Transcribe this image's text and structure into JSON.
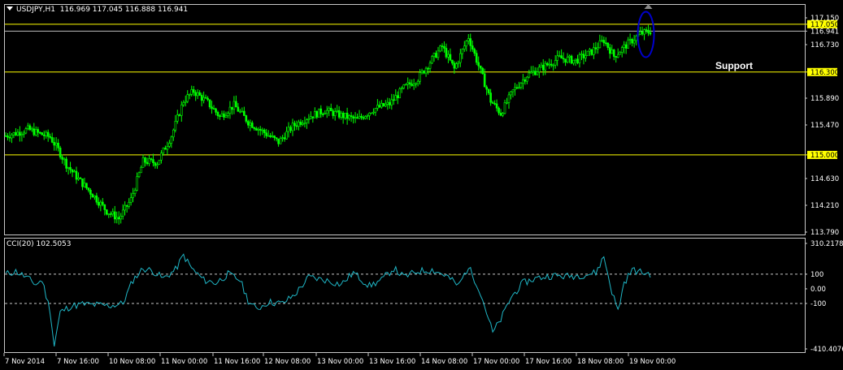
{
  "chart_header": {
    "menu_icon": "triangle-down-icon",
    "symbol": "USDJPY,H1",
    "ohlc": "116.969 117.045 116.888 116.941"
  },
  "annotation": {
    "support_label": "Support"
  },
  "cci": {
    "title": "CCI(20) 102.5053"
  },
  "colors": {
    "background": "#000000",
    "candles": "#00ff00",
    "levels": "#ffff00",
    "cci_line": "#1fb7c7",
    "ellipse": "#0000cc",
    "grid": "#c8c8c8"
  },
  "chart_data": [
    {
      "type": "candlestick",
      "symbol": "USDJPY",
      "timeframe": "H1",
      "ylim": [
        113.79,
        117.15
      ],
      "y_ticks": [
        "117.150",
        "116.730",
        "115.890",
        "115.470",
        "114.630",
        "114.210",
        "113.790"
      ],
      "x_ticks": [
        "7 Nov 2014",
        "7 Nov 16:00",
        "10 Nov 08:00",
        "11 Nov 00:00",
        "11 Nov 16:00",
        "12 Nov 08:00",
        "13 Nov 00:00",
        "13 Nov 16:00",
        "14 Nov 08:00",
        "17 Nov 00:00",
        "17 Nov 16:00",
        "18 Nov 08:00",
        "19 Nov 00:00"
      ],
      "horizontal_levels": [
        {
          "value": 117.05,
          "label": "117.050",
          "highlight": true
        },
        {
          "value": 116.941,
          "label": "116.941",
          "highlight": false
        },
        {
          "value": 116.3,
          "label": "116.300",
          "highlight": true
        },
        {
          "value": 115.0,
          "label": "115.000",
          "highlight": true
        }
      ],
      "close_path": [
        {
          "bar": 0,
          "close": 115.3
        },
        {
          "bar": 6,
          "close": 115.35
        },
        {
          "bar": 11,
          "close": 115.4
        },
        {
          "bar": 17,
          "close": 115.33
        },
        {
          "bar": 22,
          "close": 115.28
        },
        {
          "bar": 26,
          "close": 115.08
        },
        {
          "bar": 30,
          "close": 114.85
        },
        {
          "bar": 36,
          "close": 114.62
        },
        {
          "bar": 43,
          "close": 114.38
        },
        {
          "bar": 50,
          "close": 114.12
        },
        {
          "bar": 56,
          "close": 114.0
        },
        {
          "bar": 62,
          "close": 114.3
        },
        {
          "bar": 68,
          "close": 114.9
        },
        {
          "bar": 75,
          "close": 114.88
        },
        {
          "bar": 82,
          "close": 115.3
        },
        {
          "bar": 88,
          "close": 115.85
        },
        {
          "bar": 93,
          "close": 116.0
        },
        {
          "bar": 100,
          "close": 115.82
        },
        {
          "bar": 106,
          "close": 115.6
        },
        {
          "bar": 113,
          "close": 115.78
        },
        {
          "bar": 120,
          "close": 115.52
        },
        {
          "bar": 128,
          "close": 115.35
        },
        {
          "bar": 135,
          "close": 115.2
        },
        {
          "bar": 142,
          "close": 115.45
        },
        {
          "bar": 150,
          "close": 115.6
        },
        {
          "bar": 158,
          "close": 115.7
        },
        {
          "bar": 166,
          "close": 115.62
        },
        {
          "bar": 174,
          "close": 115.55
        },
        {
          "bar": 182,
          "close": 115.72
        },
        {
          "bar": 190,
          "close": 115.8
        },
        {
          "bar": 197,
          "close": 116.05
        },
        {
          "bar": 204,
          "close": 116.2
        },
        {
          "bar": 211,
          "close": 116.5
        },
        {
          "bar": 216,
          "close": 116.7
        },
        {
          "bar": 222,
          "close": 116.35
        },
        {
          "bar": 229,
          "close": 116.85
        },
        {
          "bar": 234,
          "close": 116.4
        },
        {
          "bar": 240,
          "close": 115.85
        },
        {
          "bar": 245,
          "close": 115.65
        },
        {
          "bar": 251,
          "close": 116.0
        },
        {
          "bar": 258,
          "close": 116.25
        },
        {
          "bar": 266,
          "close": 116.38
        },
        {
          "bar": 274,
          "close": 116.52
        },
        {
          "bar": 282,
          "close": 116.48
        },
        {
          "bar": 290,
          "close": 116.62
        },
        {
          "bar": 296,
          "close": 116.8
        },
        {
          "bar": 301,
          "close": 116.55
        },
        {
          "bar": 307,
          "close": 116.72
        },
        {
          "bar": 314,
          "close": 116.9
        },
        {
          "bar": 319,
          "close": 116.94
        }
      ]
    },
    {
      "type": "line",
      "name": "CCI(20)",
      "value": 102.5053,
      "ylim": [
        -410.4076,
        310.2178
      ],
      "y_ticks": [
        "310.2178",
        "100",
        "0.00",
        "-100",
        "-410.4076"
      ],
      "reference_lines": [
        100,
        -100
      ],
      "points": [
        {
          "bar": 0,
          "y": 100
        },
        {
          "bar": 5,
          "y": 120
        },
        {
          "bar": 10,
          "y": 80
        },
        {
          "bar": 15,
          "y": 30
        },
        {
          "bar": 18,
          "y": 60
        },
        {
          "bar": 22,
          "y": -150
        },
        {
          "bar": 24,
          "y": -390
        },
        {
          "bar": 27,
          "y": -160
        },
        {
          "bar": 32,
          "y": -120
        },
        {
          "bar": 38,
          "y": -105
        },
        {
          "bar": 45,
          "y": -110
        },
        {
          "bar": 52,
          "y": -115
        },
        {
          "bar": 58,
          "y": -100
        },
        {
          "bar": 63,
          "y": 60
        },
        {
          "bar": 68,
          "y": 140
        },
        {
          "bar": 73,
          "y": 120
        },
        {
          "bar": 78,
          "y": 70
        },
        {
          "bar": 84,
          "y": 130
        },
        {
          "bar": 88,
          "y": 230
        },
        {
          "bar": 92,
          "y": 140
        },
        {
          "bar": 98,
          "y": 60
        },
        {
          "bar": 104,
          "y": 40
        },
        {
          "bar": 110,
          "y": 100
        },
        {
          "bar": 116,
          "y": 60
        },
        {
          "bar": 120,
          "y": -80
        },
        {
          "bar": 124,
          "y": -140
        },
        {
          "bar": 130,
          "y": -90
        },
        {
          "bar": 137,
          "y": -100
        },
        {
          "bar": 143,
          "y": -40
        },
        {
          "bar": 150,
          "y": 80
        },
        {
          "bar": 158,
          "y": 60
        },
        {
          "bar": 166,
          "y": 30
        },
        {
          "bar": 172,
          "y": 110
        },
        {
          "bar": 180,
          "y": 20
        },
        {
          "bar": 186,
          "y": 60
        },
        {
          "bar": 192,
          "y": 140
        },
        {
          "bar": 197,
          "y": 80
        },
        {
          "bar": 204,
          "y": 120
        },
        {
          "bar": 211,
          "y": 130
        },
        {
          "bar": 218,
          "y": 90
        },
        {
          "bar": 224,
          "y": 20
        },
        {
          "bar": 229,
          "y": 150
        },
        {
          "bar": 234,
          "y": 10
        },
        {
          "bar": 238,
          "y": -160
        },
        {
          "bar": 241,
          "y": -300
        },
        {
          "bar": 245,
          "y": -210
        },
        {
          "bar": 250,
          "y": -60
        },
        {
          "bar": 256,
          "y": 40
        },
        {
          "bar": 262,
          "y": 70
        },
        {
          "bar": 270,
          "y": 90
        },
        {
          "bar": 278,
          "y": 85
        },
        {
          "bar": 286,
          "y": 95
        },
        {
          "bar": 292,
          "y": 110
        },
        {
          "bar": 296,
          "y": 220
        },
        {
          "bar": 300,
          "y": -20
        },
        {
          "bar": 303,
          "y": -150
        },
        {
          "bar": 306,
          "y": 40
        },
        {
          "bar": 310,
          "y": 130
        },
        {
          "bar": 315,
          "y": 110
        },
        {
          "bar": 319,
          "y": 102.5
        }
      ]
    }
  ]
}
